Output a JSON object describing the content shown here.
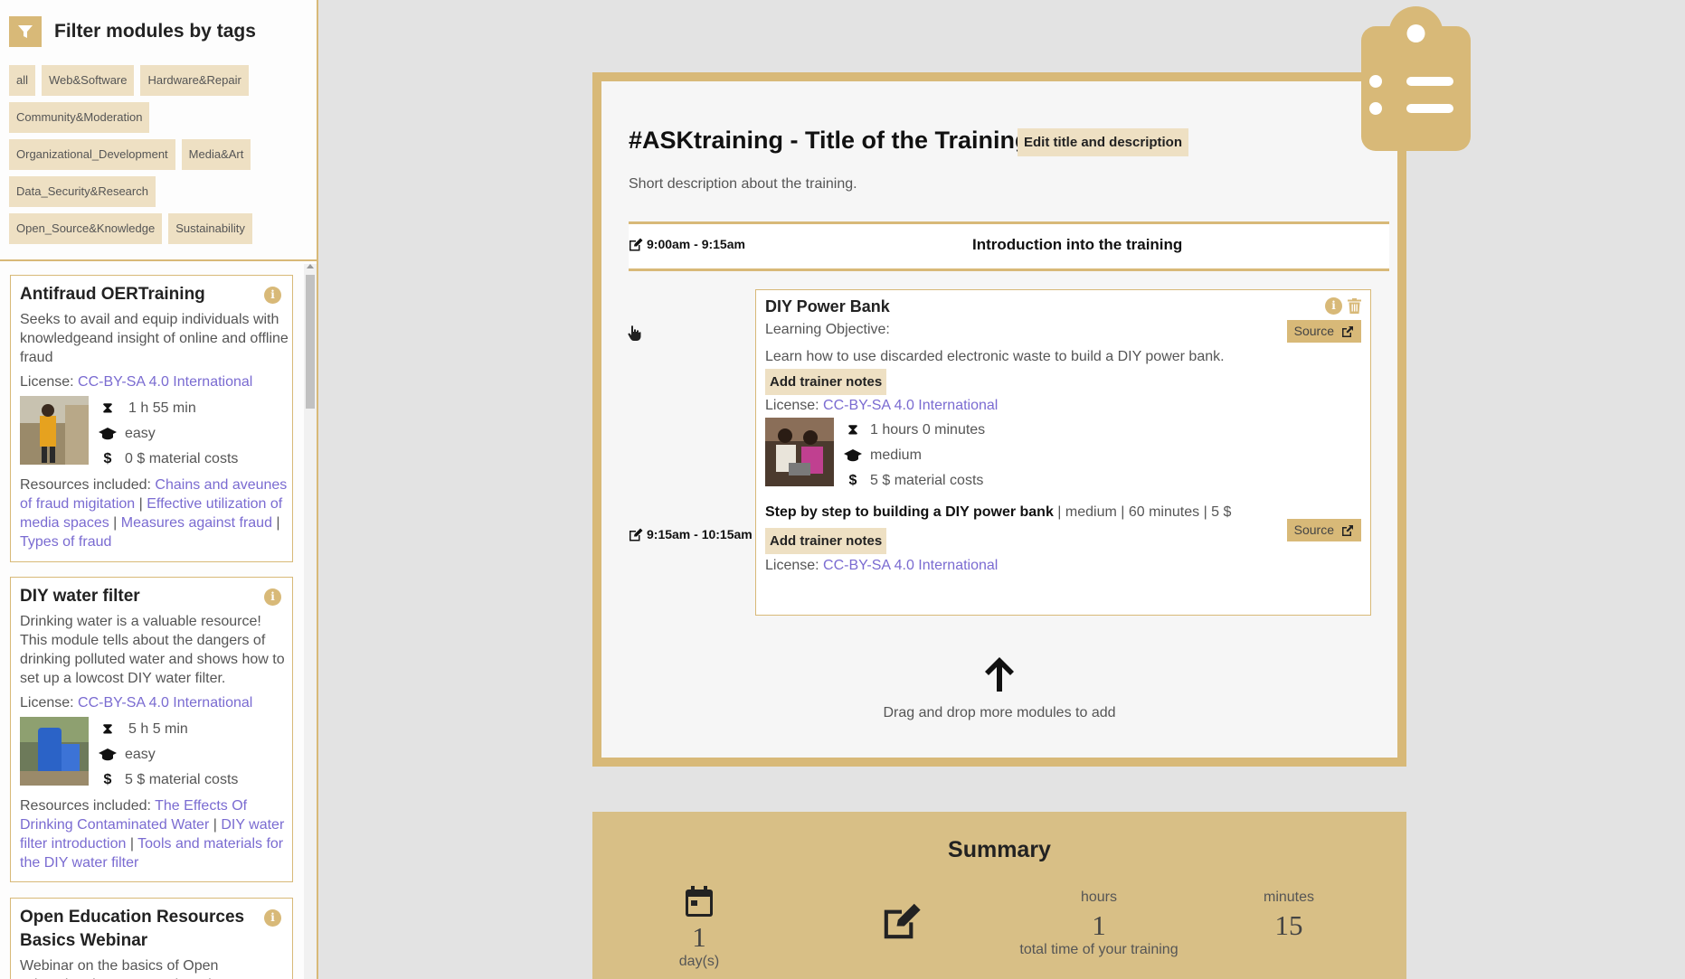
{
  "sidebar": {
    "filter_title": "Filter modules by tags",
    "tags": [
      "all",
      "Web&Software",
      "Hardware&Repair",
      "Community&Moderation",
      "Organizational_Development",
      "Media&Art",
      "Data_Security&Research",
      "Open_Source&Knowledge",
      "Sustainability"
    ],
    "modules": [
      {
        "title": "Antifraud OERTraining",
        "description": "Seeks to avail and equip individuals with knowledgeand insight of online and offline fraud",
        "license_label": "License:",
        "license": "CC-BY-SA 4.0 International",
        "duration": "1 h 55 min",
        "difficulty": "easy",
        "cost": "0 $ material costs",
        "resources_label": "Resources included:",
        "resources": [
          "Chains and aveunes of fraud migitation",
          "Effective utilization of media spaces",
          "Measures against fraud",
          "Types of fraud"
        ]
      },
      {
        "title": "DIY water filter",
        "description": "Drinking water is a valuable resource! This module tells about the dangers of drinking polluted water and shows how to set up a lowcost DIY water filter.",
        "license_label": "License:",
        "license": "CC-BY-SA 4.0 International",
        "duration": "5 h 5 min",
        "difficulty": "easy",
        "cost": "5 $ material costs",
        "resources_label": "Resources included:",
        "resources": [
          "The Effects Of Drinking Contaminated Water",
          "DIY water filter introduction",
          "Tools and materials for the DIY water filter"
        ]
      },
      {
        "title": "Open Education Resources Basics Webinar",
        "description": "Webinar on the basics of Open Educational Resources (OER) to..."
      }
    ]
  },
  "training": {
    "title": "#ASKtraining - Title of the Training",
    "edit_label": "Edit title and description",
    "description": "Short description about the training.",
    "intro": {
      "time": "9:00am - 9:15am",
      "title": "Introduction into the training"
    },
    "slot_time": "9:15am - 10:15am",
    "module": {
      "title": "DIY Power Bank",
      "source_label": "Source",
      "objective_label": "Learning Objective:",
      "objective": "Learn how to use discarded electronic waste to build a DIY power bank.",
      "notes_label": "Add trainer notes",
      "license_label": "License:",
      "license": "CC-BY-SA 4.0 International",
      "duration": "1 hours 0 minutes",
      "difficulty": "medium",
      "cost": "5 $ material costs",
      "step": {
        "title": "Step by step to building a DIY power bank",
        "details": " | medium | 60 minutes | 5 $",
        "source_label": "Source",
        "notes_label": "Add trainer notes",
        "license_label": "License:",
        "license": "CC-BY-SA 4.0 International"
      }
    },
    "drop_text": "Drag and drop more modules to add"
  },
  "summary": {
    "title": "Summary",
    "days_value": "1",
    "days_label": "day(s)",
    "hours_label": "hours",
    "hours_value": "1",
    "minutes_label": "minutes",
    "minutes_value": "15",
    "total_label": "total time of your training"
  },
  "colors": {
    "accent": "#d8b978",
    "tag_bg": "#eee0c3",
    "link": "#7a6bd1",
    "summary_bg": "#d8bf86"
  }
}
